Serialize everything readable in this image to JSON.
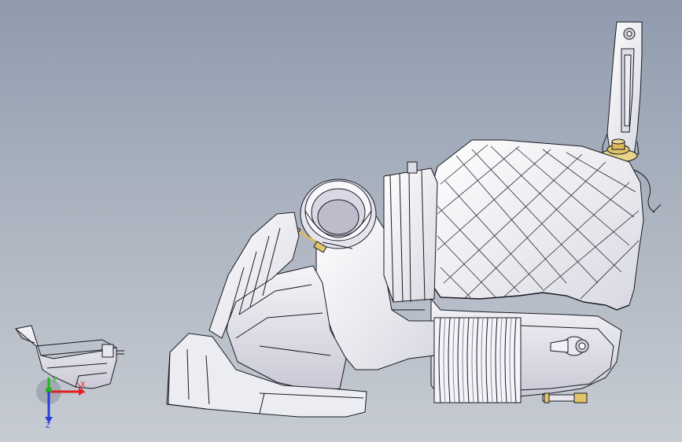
{
  "viewport": {
    "background_top": "#8f9bad",
    "background_bottom": "#c7ccd3"
  },
  "model": {
    "part_color": "#f1f1f6",
    "edge_color": "#1a1a22",
    "hardware_color": "#e2c46a"
  },
  "triad": {
    "x_label": "X",
    "y_label": "Y",
    "z_label": "Z",
    "x_color": "#e02020",
    "y_color": "#1fb31f",
    "z_color": "#2a3fd6"
  }
}
